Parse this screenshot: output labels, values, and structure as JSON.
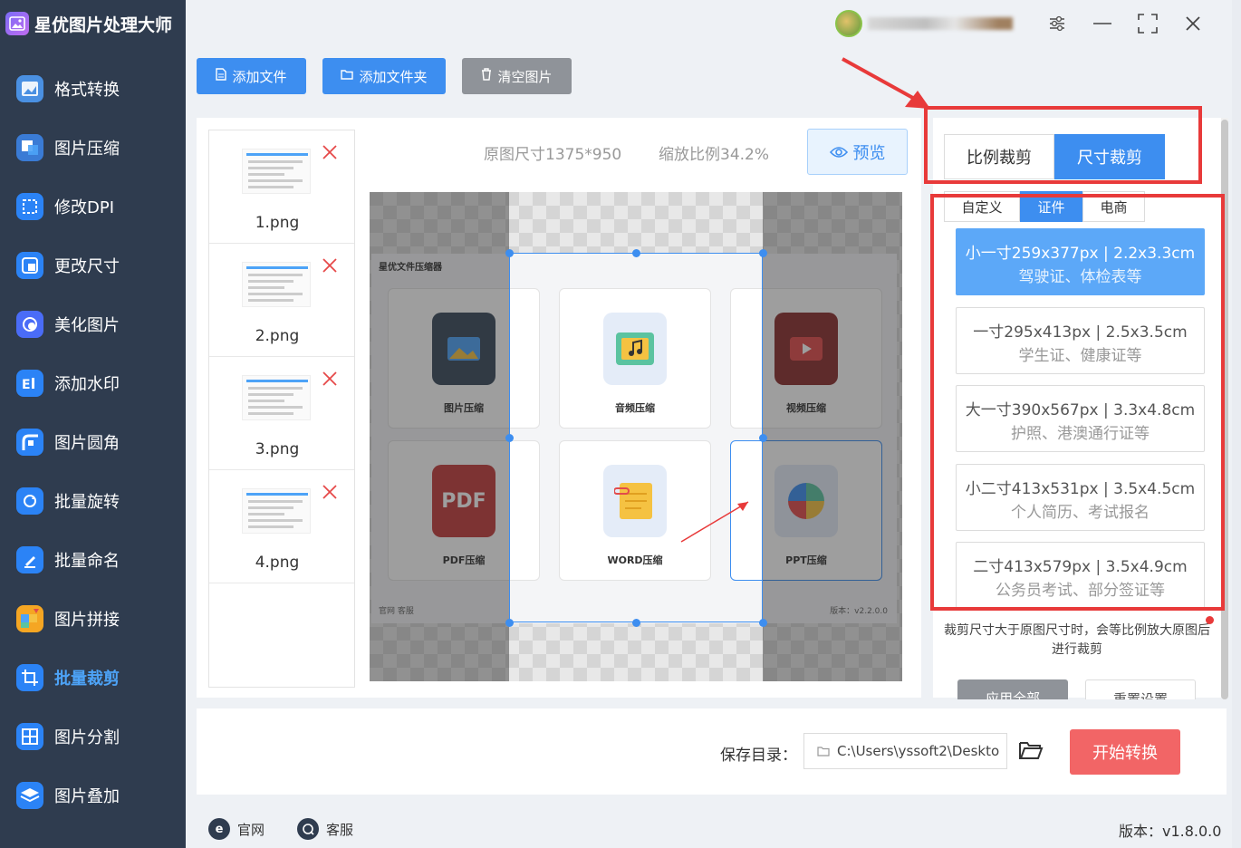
{
  "app": {
    "title": "星优图片处理大师"
  },
  "sidebar": {
    "items": [
      {
        "label": "格式转换",
        "icon": "format-convert-icon",
        "color": "#4a90e2"
      },
      {
        "label": "图片压缩",
        "icon": "compress-icon",
        "color": "#3a7bd5"
      },
      {
        "label": "修改DPI",
        "icon": "dpi-icon",
        "color": "#2b83f6"
      },
      {
        "label": "更改尺寸",
        "icon": "resize-icon",
        "color": "#2b83f6"
      },
      {
        "label": "美化图片",
        "icon": "beautify-icon",
        "color": "#4a6cf7"
      },
      {
        "label": "添加水印",
        "icon": "watermark-icon",
        "color": "#2b83f6"
      },
      {
        "label": "图片圆角",
        "icon": "round-corner-icon",
        "color": "#2b83f6"
      },
      {
        "label": "批量旋转",
        "icon": "rotate-icon",
        "color": "#2b83f6"
      },
      {
        "label": "批量命名",
        "icon": "rename-icon",
        "color": "#2b83f6"
      },
      {
        "label": "图片拼接",
        "icon": "stitch-icon",
        "color": "#f5a623"
      },
      {
        "label": "批量裁剪",
        "icon": "crop-icon",
        "color": "#2b83f6"
      },
      {
        "label": "图片分割",
        "icon": "split-icon",
        "color": "#2b83f6"
      },
      {
        "label": "图片叠加",
        "icon": "overlay-icon",
        "color": "#2b83f6"
      }
    ],
    "active_index": 10
  },
  "toolbar": {
    "add_file": "添加文件",
    "add_folder": "添加文件夹",
    "clear": "清空图片"
  },
  "files": [
    {
      "name": "1.png"
    },
    {
      "name": "2.png"
    },
    {
      "name": "3.png"
    },
    {
      "name": "4.png"
    }
  ],
  "preview": {
    "original_size": "原图尺寸1375*950",
    "scale": "缩放比例34.2%",
    "preview_button": "预览",
    "inner_app_title": "星优文件压缩器",
    "inner_cards": [
      "图片压缩",
      "音频压缩",
      "视频压缩",
      "PDF压缩",
      "WORD压缩",
      "PPT压缩"
    ],
    "inner_pdf_text": "PDF",
    "inner_footer": "官网   客服",
    "inner_version": "版本：v2.2.0.0"
  },
  "settings": {
    "mode_tabs": [
      "比例裁剪",
      "尺寸裁剪"
    ],
    "active_mode": 1,
    "sub_tabs": [
      "自定义",
      "证件",
      "电商"
    ],
    "active_sub_tab": 1,
    "presets": [
      {
        "line1": "小一寸259x377px | 2.2x3.3cm",
        "line2": "驾驶证、体检表等"
      },
      {
        "line1": "一寸295x413px | 2.5x3.5cm",
        "line2": "学生证、健康证等"
      },
      {
        "line1": "大一寸390x567px | 3.3x4.8cm",
        "line2": "护照、港澳通行证等"
      },
      {
        "line1": "小二寸413x531px | 3.5x4.5cm",
        "line2": "个人简历、考试报名"
      },
      {
        "line1": "二寸413x579px | 3.5x4.9cm",
        "line2": "公务员考试、部分签证等"
      }
    ],
    "selected_preset": 0,
    "note": "裁剪尺寸大于原图尺寸时，会等比例放大原图后进行裁剪",
    "apply_all": "应用全部",
    "reset": "重置设置"
  },
  "output": {
    "save_label": "保存目录：",
    "save_path": "C:\\Users\\yssoft2\\Deskto",
    "start_button": "开始转换"
  },
  "footer": {
    "website": "官网",
    "support": "客服",
    "version": "版本：v1.8.0.0"
  },
  "colors": {
    "sidebar_bg": "#2f3c4f",
    "primary": "#3d8ef0",
    "danger": "#f26566",
    "annotation_red": "#e83a3a",
    "active_nav": "#4da3f7"
  }
}
